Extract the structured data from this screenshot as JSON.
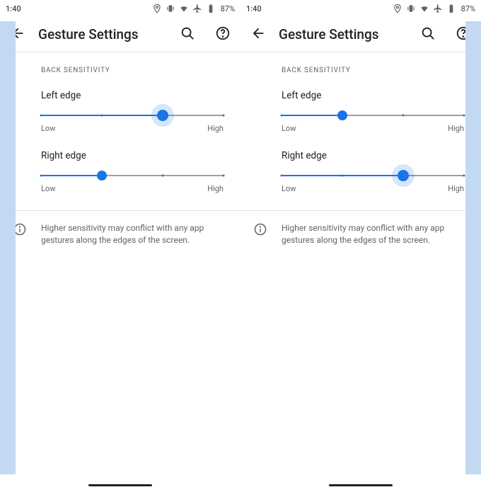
{
  "phones": [
    {
      "clock": "1:40",
      "battery_pct": "87%",
      "edge_highlight": "left",
      "title": "Gesture Settings",
      "section_header": "BACK SENSITIVITY",
      "slider1": {
        "label": "Left edge",
        "low": "Low",
        "high": "High",
        "pos": 66.6,
        "big": true
      },
      "slider2": {
        "label": "Right edge",
        "low": "Low",
        "high": "High",
        "pos": 33.3,
        "big": false
      },
      "info_text": "Higher sensitivity may conflict with any app gestures along the edges of the screen."
    },
    {
      "clock": "1:40",
      "battery_pct": "87%",
      "edge_highlight": "right",
      "title": "Gesture Settings",
      "section_header": "BACK SENSITIVITY",
      "slider1": {
        "label": "Left edge",
        "low": "Low",
        "high": "High",
        "pos": 33.3,
        "big": false
      },
      "slider2": {
        "label": "Right edge",
        "low": "Low",
        "high": "High",
        "pos": 66.6,
        "big": true
      },
      "info_text": "Higher sensitivity may conflict with any app gestures along the edges of the screen."
    }
  ]
}
